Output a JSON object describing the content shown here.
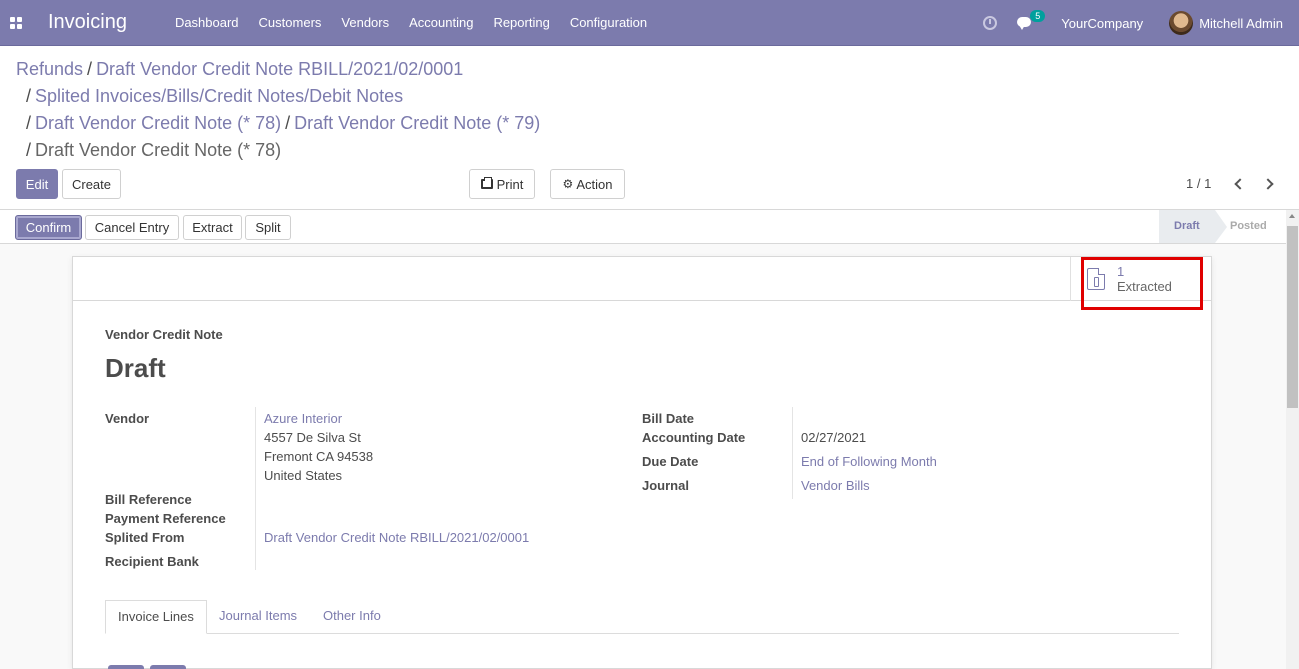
{
  "navbar": {
    "app_name": "Invoicing",
    "menu": [
      "Dashboard",
      "Customers",
      "Vendors",
      "Accounting",
      "Reporting",
      "Configuration"
    ],
    "chat_count": "5",
    "company": "YourCompany",
    "user": "Mitchell Admin"
  },
  "breadcrumb": {
    "items": [
      "Refunds",
      "Draft Vendor Credit Note RBILL/2021/02/0001",
      "Splited Invoices/Bills/Credit Notes/Debit Notes",
      "Draft Vendor Credit Note (* 78)",
      "Draft Vendor Credit Note (* 79)",
      "Draft Vendor Credit Note (* 78)"
    ],
    "separator": "/"
  },
  "buttons": {
    "edit": "Edit",
    "create": "Create",
    "print": "Print",
    "action": "Action"
  },
  "pager": {
    "value": "1 / 1"
  },
  "statusbar": {
    "confirm": "Confirm",
    "cancel_entry": "Cancel Entry",
    "extract": "Extract",
    "split": "Split",
    "stages": [
      "Draft",
      "Posted"
    ],
    "current_stage": "Draft"
  },
  "smart_button": {
    "count": "1",
    "label": "Extracted"
  },
  "sheet": {
    "doc_type": "Vendor Credit Note",
    "title": "Draft",
    "left_fields": {
      "vendor_label": "Vendor",
      "vendor_name": "Azure Interior",
      "vendor_address": [
        "4557 De Silva St",
        "Fremont CA 94538",
        "United States"
      ],
      "bill_reference_label": "Bill Reference",
      "payment_reference_label": "Payment Reference",
      "splited_from_label": "Splited From",
      "splited_from_value": "Draft Vendor Credit Note RBILL/2021/02/0001",
      "recipient_bank_label": "Recipient Bank"
    },
    "right_fields": {
      "bill_date_label": "Bill Date",
      "accounting_date_label": "Accounting Date",
      "accounting_date_value": "02/27/2021",
      "due_date_label": "Due Date",
      "due_date_value": "End of Following Month",
      "journal_label": "Journal",
      "journal_value": "Vendor Bills"
    },
    "tabs": [
      "Invoice Lines",
      "Journal Items",
      "Other Info"
    ]
  },
  "colors": {
    "brand": "#7c7bad",
    "highlight": "#e00000",
    "badge": "#00a09d"
  }
}
